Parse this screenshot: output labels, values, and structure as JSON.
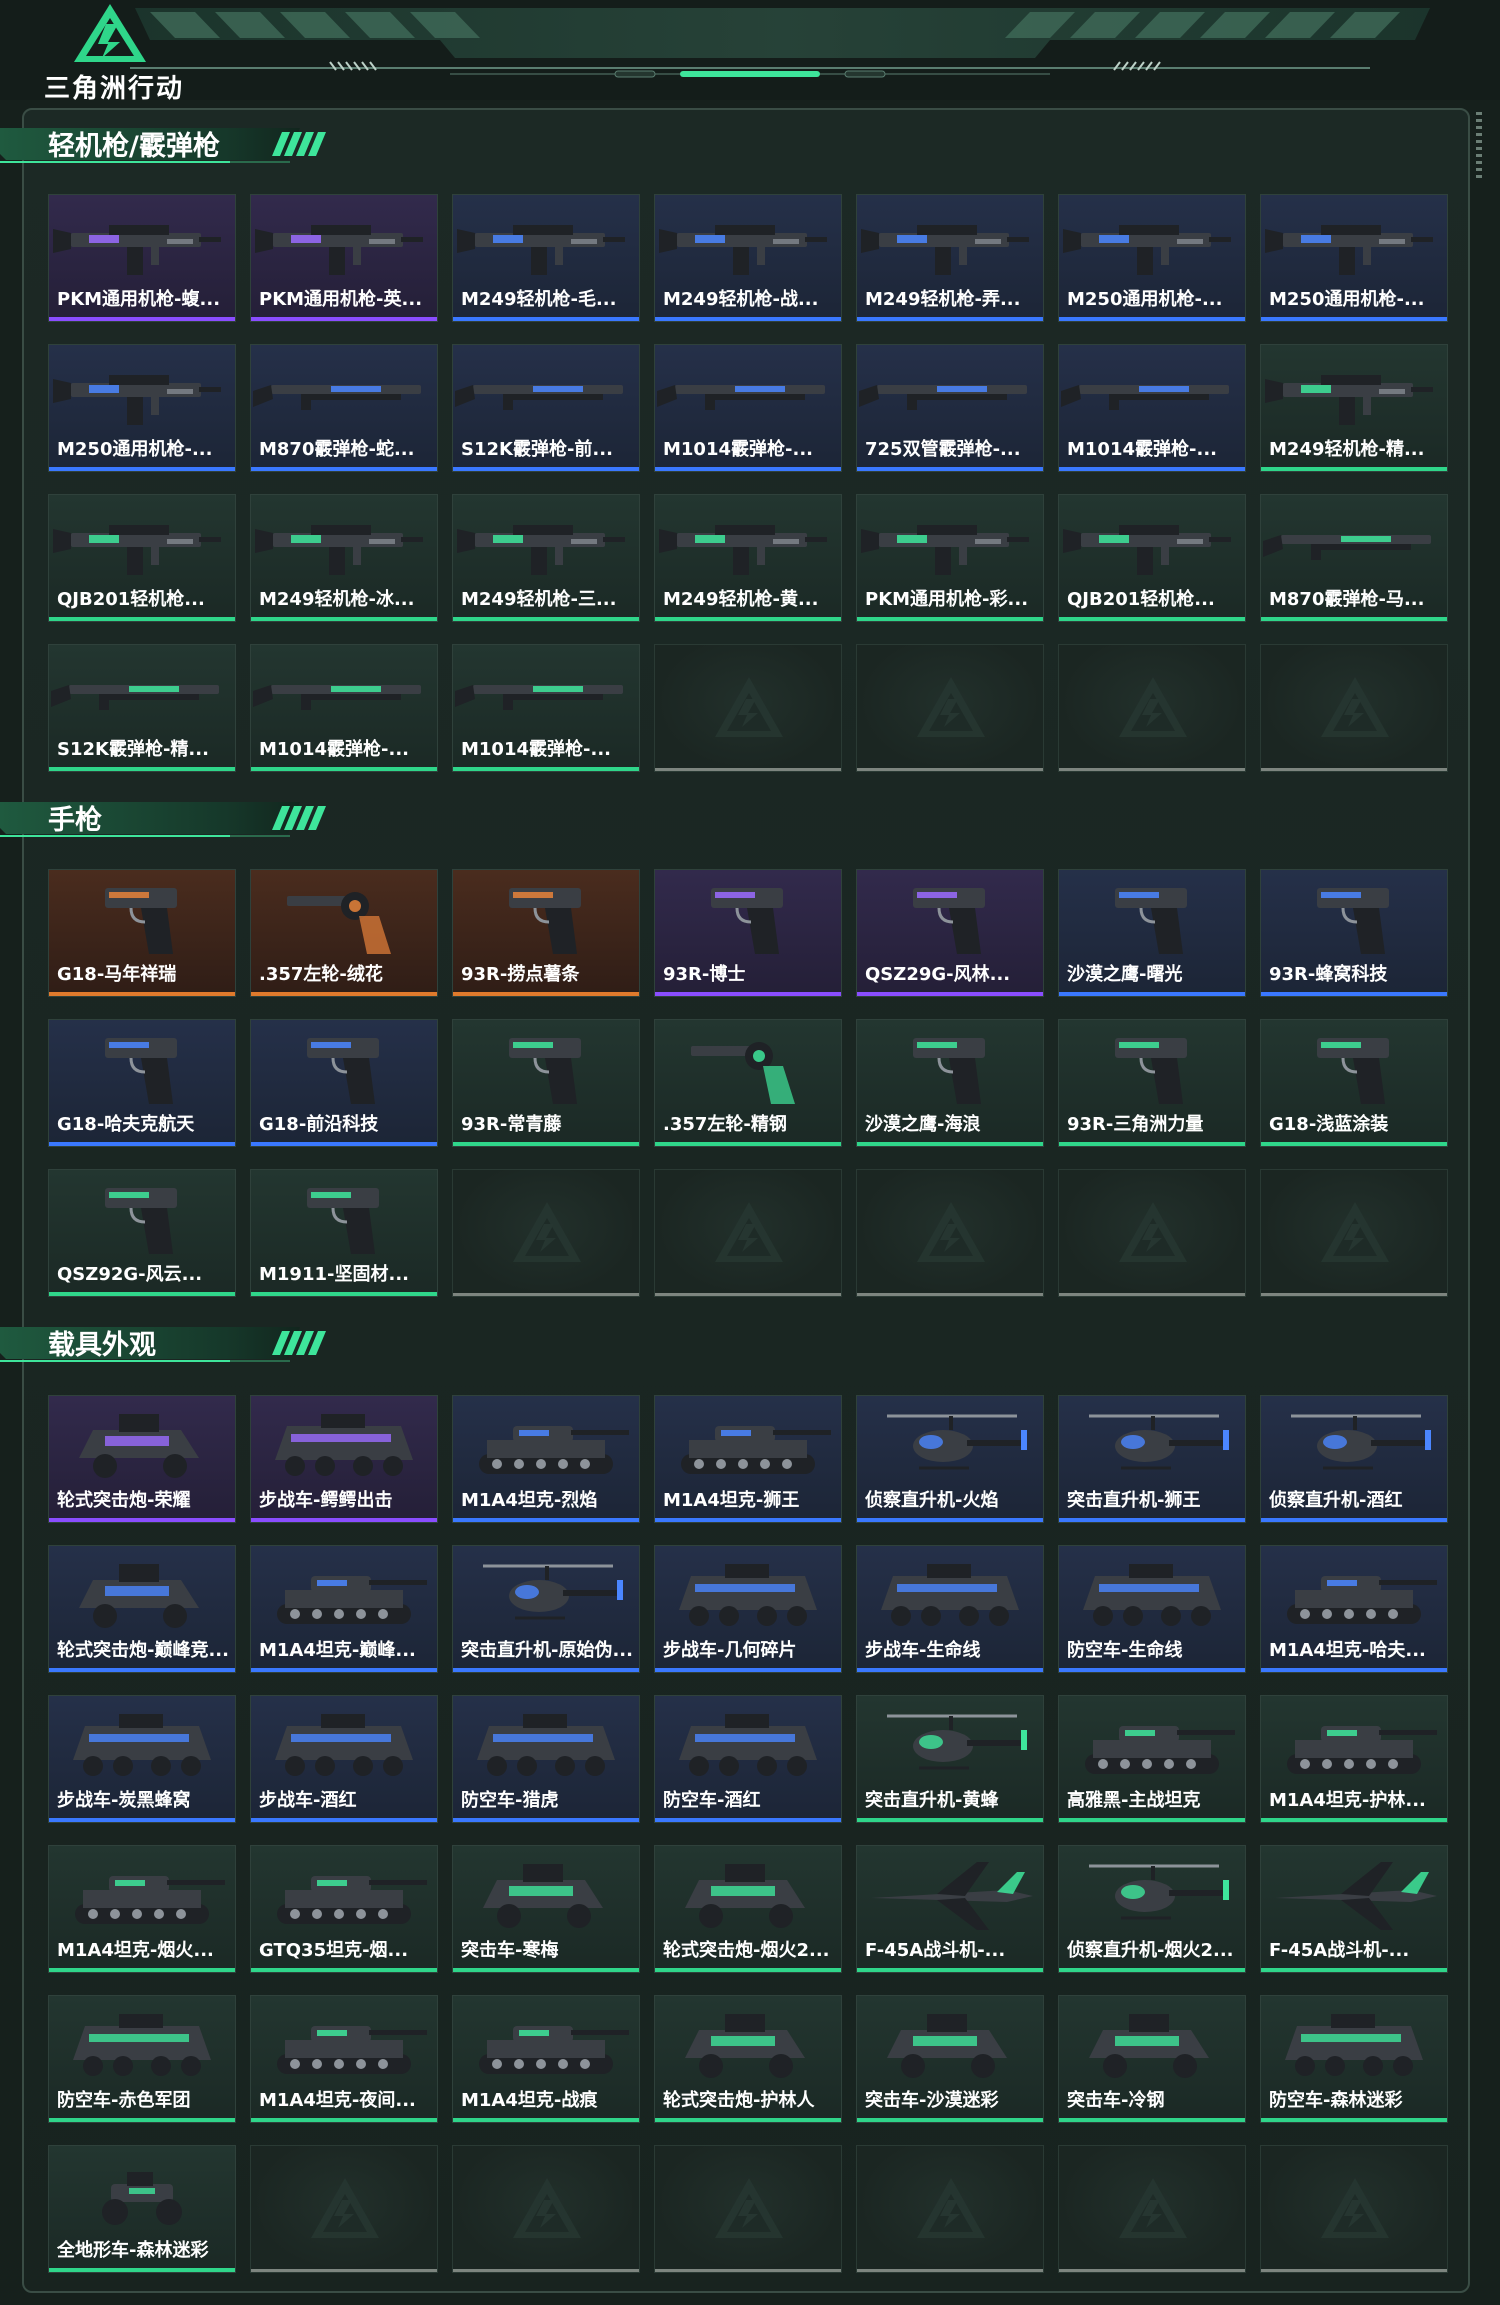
{
  "app": {
    "logo_text": "三角洲行动",
    "accent": "#3ee59b"
  },
  "rarity_colors": {
    "purple": "#8a4dff",
    "blue": "#3a78ff",
    "green": "#2fd68a",
    "orange": "#e07a2c",
    "gray": "#7d857f"
  },
  "sections": [
    {
      "id": "smg",
      "title": "轻机枪/霰弹枪",
      "items": [
        {
          "label": "PKM通用机枪-蝮...",
          "rarity": "purple",
          "icon": "gun-icon"
        },
        {
          "label": "PKM通用机枪-英...",
          "rarity": "purple",
          "icon": "gun-icon"
        },
        {
          "label": "M249轻机枪-毛...",
          "rarity": "blue",
          "icon": "gun-icon"
        },
        {
          "label": "M249轻机枪-战...",
          "rarity": "blue",
          "icon": "gun-icon"
        },
        {
          "label": "M249轻机枪-弄...",
          "rarity": "blue",
          "icon": "gun-icon"
        },
        {
          "label": "M250通用机枪-...",
          "rarity": "blue",
          "icon": "gun-icon"
        },
        {
          "label": "M250通用机枪-...",
          "rarity": "blue",
          "icon": "gun-icon"
        },
        {
          "label": "M250通用机枪-...",
          "rarity": "blue",
          "icon": "gun-icon"
        },
        {
          "label": "M870霰弹枪-蛇...",
          "rarity": "blue",
          "icon": "shotgun-icon"
        },
        {
          "label": "S12K霰弹枪-前...",
          "rarity": "blue",
          "icon": "shotgun-icon"
        },
        {
          "label": "M1014霰弹枪-...",
          "rarity": "blue",
          "icon": "shotgun-icon"
        },
        {
          "label": "725双管霰弹枪-...",
          "rarity": "blue",
          "icon": "shotgun-icon"
        },
        {
          "label": "M1014霰弹枪-...",
          "rarity": "blue",
          "icon": "shotgun-icon"
        },
        {
          "label": "M249轻机枪-精...",
          "rarity": "green",
          "icon": "gun-icon"
        },
        {
          "label": "QJB201轻机枪...",
          "rarity": "green",
          "icon": "gun-icon"
        },
        {
          "label": "M249轻机枪-冰...",
          "rarity": "green",
          "icon": "gun-icon"
        },
        {
          "label": "M249轻机枪-三...",
          "rarity": "green",
          "icon": "gun-icon"
        },
        {
          "label": "M249轻机枪-黄...",
          "rarity": "green",
          "icon": "gun-icon"
        },
        {
          "label": "PKM通用机枪-彩...",
          "rarity": "green",
          "icon": "gun-icon"
        },
        {
          "label": "QJB201轻机枪...",
          "rarity": "green",
          "icon": "gun-icon"
        },
        {
          "label": "M870霰弹枪-马...",
          "rarity": "green",
          "icon": "shotgun-icon"
        },
        {
          "label": "S12K霰弹枪-精...",
          "rarity": "green",
          "icon": "shotgun-icon"
        },
        {
          "label": "M1014霰弹枪-...",
          "rarity": "green",
          "icon": "shotgun-icon"
        },
        {
          "label": "M1014霰弹枪-...",
          "rarity": "green",
          "icon": "shotgun-icon"
        },
        null,
        null,
        null,
        null
      ]
    },
    {
      "id": "pistol",
      "title": "手枪",
      "items": [
        {
          "label": "G18-马年祥瑞",
          "rarity": "orange",
          "icon": "pistol-icon"
        },
        {
          "label": ".357左轮-绒花",
          "rarity": "orange",
          "icon": "revolver-icon"
        },
        {
          "label": "93R-捞点薯条",
          "rarity": "orange",
          "icon": "pistol-icon"
        },
        {
          "label": "93R-博士",
          "rarity": "purple",
          "icon": "pistol-icon"
        },
        {
          "label": "QSZ29G-风林...",
          "rarity": "purple",
          "icon": "pistol-icon"
        },
        {
          "label": "沙漠之鹰-曙光",
          "rarity": "blue",
          "icon": "pistol-icon"
        },
        {
          "label": "93R-蜂窝科技",
          "rarity": "blue",
          "icon": "pistol-icon"
        },
        {
          "label": "G18-哈夫克航天",
          "rarity": "blue",
          "icon": "pistol-icon"
        },
        {
          "label": "G18-前沿科技",
          "rarity": "blue",
          "icon": "pistol-icon"
        },
        {
          "label": "93R-常青藤",
          "rarity": "green",
          "icon": "pistol-icon"
        },
        {
          "label": ".357左轮-精钢",
          "rarity": "green",
          "icon": "revolver-icon"
        },
        {
          "label": "沙漠之鹰-海浪",
          "rarity": "green",
          "icon": "pistol-icon"
        },
        {
          "label": "93R-三角洲力量",
          "rarity": "green",
          "icon": "pistol-icon"
        },
        {
          "label": "G18-浅蓝涂装",
          "rarity": "green",
          "icon": "pistol-icon"
        },
        {
          "label": "QSZ92G-风云...",
          "rarity": "green",
          "icon": "pistol-icon"
        },
        {
          "label": "M1911-坚固材...",
          "rarity": "green",
          "icon": "pistol-icon"
        },
        null,
        null,
        null,
        null,
        null
      ]
    },
    {
      "id": "vehicle",
      "title": "载具外观",
      "items": [
        {
          "label": "轮式突击炮-荣耀",
          "rarity": "purple",
          "icon": "armored-car-icon"
        },
        {
          "label": "步战车-鳄鳄出击",
          "rarity": "purple",
          "icon": "apc-icon"
        },
        {
          "label": "M1A4坦克-烈焰",
          "rarity": "blue",
          "icon": "tank-icon"
        },
        {
          "label": "M1A4坦克-狮王",
          "rarity": "blue",
          "icon": "tank-icon"
        },
        {
          "label": "侦察直升机-火焰",
          "rarity": "blue",
          "icon": "helicopter-icon"
        },
        {
          "label": "突击直升机-狮王",
          "rarity": "blue",
          "icon": "helicopter-icon"
        },
        {
          "label": "侦察直升机-酒红",
          "rarity": "blue",
          "icon": "helicopter-icon"
        },
        {
          "label": "轮式突击炮-巅峰竞...",
          "rarity": "blue",
          "icon": "armored-car-icon"
        },
        {
          "label": "M1A4坦克-巅峰...",
          "rarity": "blue",
          "icon": "tank-icon"
        },
        {
          "label": "突击直升机-原始伪...",
          "rarity": "blue",
          "icon": "helicopter-icon"
        },
        {
          "label": "步战车-几何碎片",
          "rarity": "blue",
          "icon": "apc-icon"
        },
        {
          "label": "步战车-生命线",
          "rarity": "blue",
          "icon": "apc-icon"
        },
        {
          "label": "防空车-生命线",
          "rarity": "blue",
          "icon": "apc-icon"
        },
        {
          "label": "M1A4坦克-哈夫...",
          "rarity": "blue",
          "icon": "tank-icon"
        },
        {
          "label": "步战车-炭黑蜂窝",
          "rarity": "blue",
          "icon": "apc-icon"
        },
        {
          "label": "步战车-酒红",
          "rarity": "blue",
          "icon": "apc-icon"
        },
        {
          "label": "防空车-猎虎",
          "rarity": "blue",
          "icon": "apc-icon"
        },
        {
          "label": "防空车-酒红",
          "rarity": "blue",
          "icon": "apc-icon"
        },
        {
          "label": "突击直升机-黄蜂",
          "rarity": "green",
          "icon": "helicopter-icon"
        },
        {
          "label": "高雅黑-主战坦克",
          "rarity": "green",
          "icon": "tank-icon"
        },
        {
          "label": "M1A4坦克-护林...",
          "rarity": "green",
          "icon": "tank-icon"
        },
        {
          "label": "M1A4坦克-烟火...",
          "rarity": "green",
          "icon": "tank-icon"
        },
        {
          "label": "GTQ35坦克-烟...",
          "rarity": "green",
          "icon": "tank-icon"
        },
        {
          "label": "突击车-寒梅",
          "rarity": "green",
          "icon": "armored-car-icon"
        },
        {
          "label": "轮式突击炮-烟火2...",
          "rarity": "green",
          "icon": "armored-car-icon"
        },
        {
          "label": "F-45A战斗机-...",
          "rarity": "green",
          "icon": "jet-icon"
        },
        {
          "label": "侦察直升机-烟火2...",
          "rarity": "green",
          "icon": "helicopter-icon"
        },
        {
          "label": "F-45A战斗机-...",
          "rarity": "green",
          "icon": "jet-icon"
        },
        {
          "label": "防空车-赤色军团",
          "rarity": "green",
          "icon": "apc-icon"
        },
        {
          "label": "M1A4坦克-夜间...",
          "rarity": "green",
          "icon": "tank-icon"
        },
        {
          "label": "M1A4坦克-战痕",
          "rarity": "green",
          "icon": "tank-icon"
        },
        {
          "label": "轮式突击炮-护林人",
          "rarity": "green",
          "icon": "armored-car-icon"
        },
        {
          "label": "突击车-沙漠迷彩",
          "rarity": "green",
          "icon": "armored-car-icon"
        },
        {
          "label": "突击车-冷钢",
          "rarity": "green",
          "icon": "armored-car-icon"
        },
        {
          "label": "防空车-森林迷彩",
          "rarity": "green",
          "icon": "apc-icon"
        },
        {
          "label": "全地形车-森林迷彩",
          "rarity": "green",
          "icon": "atv-icon"
        },
        null,
        null,
        null,
        null,
        null,
        null
      ]
    }
  ]
}
